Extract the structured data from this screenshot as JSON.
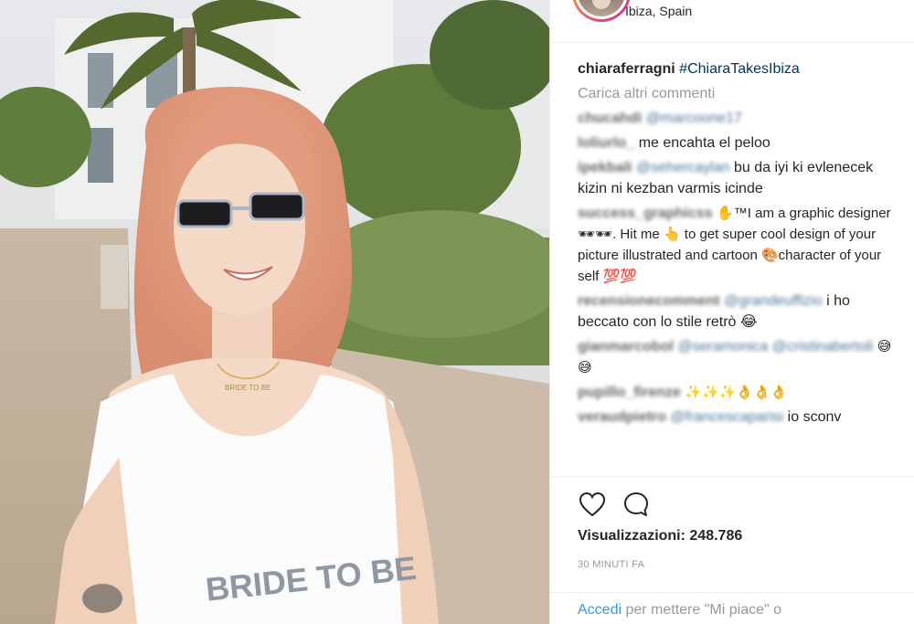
{
  "post": {
    "location": "Ibiza, Spain",
    "caption_user": "chiaraferragni",
    "caption_hashtag": "#ChiaraTakesIbiza",
    "load_more": "Carica altri commenti",
    "comments": [
      {
        "user": "chucahdi",
        "mention": "@marcoone17",
        "text": ""
      },
      {
        "user": "loliurlo_",
        "mention": "",
        "text": "me encahta el peloo"
      },
      {
        "user": "ipekbali",
        "mention": "@sehercaylan",
        "text": "bu da iyi ki evlenecek kizin ni kezban varmis icinde"
      },
      {
        "user": "success_graphicss",
        "mention": "",
        "text": "✋™I am a graphic designer🕶🕶. Hit me 👆 to get super cool design of your picture illustrated and cartoon 🎨character of your self 💯💯"
      },
      {
        "user": "recensionecomment",
        "mention": "@grandeuffizio",
        "text": "i ho beccato con lo stile retrò 😂"
      },
      {
        "user": "gianmarcobol",
        "mention": "@seramonica @cristinabertoli",
        "text": "😅😅"
      },
      {
        "user": "pupillo_firenze",
        "mention": "",
        "text": "✨✨✨👌👌👌"
      },
      {
        "user": "veraudpietro",
        "mention": "@francescaparisi",
        "text": "io sconv"
      }
    ],
    "views_label": "Visualizzazioni:",
    "views_count": "248.786",
    "time_ago": "30 MINUTI FA",
    "login_link": "Accedi",
    "login_text": "per mettere \"Mi piace\" o"
  },
  "icons": {
    "like": "heart-icon",
    "comment": "comment-bubble-icon"
  },
  "video": {
    "shirt_text": "BRIDE TO BE",
    "necklace_text": "BRIDE TO BE"
  }
}
